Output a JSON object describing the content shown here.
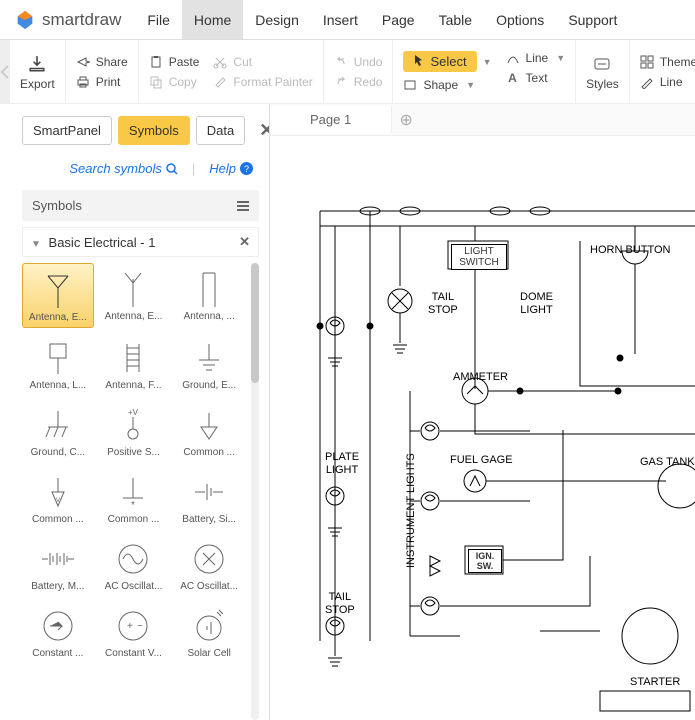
{
  "app": {
    "name": "smartdraw"
  },
  "menu": [
    "File",
    "Home",
    "Design",
    "Insert",
    "Page",
    "Table",
    "Options",
    "Support"
  ],
  "menu_active": "Home",
  "ribbon": {
    "export": "Export",
    "share": "Share",
    "print": "Print",
    "paste": "Paste",
    "copy": "Copy",
    "cut": "Cut",
    "format_painter": "Format Painter",
    "undo": "Undo",
    "redo": "Redo",
    "select": "Select",
    "shape": "Shape",
    "line": "Line",
    "text": "Text",
    "styles": "Styles",
    "themes": "Themes",
    "line2": "Line"
  },
  "panel": {
    "tabs": [
      "SmartPanel",
      "Symbols",
      "Data"
    ],
    "active": "Symbols",
    "search": "Search symbols",
    "help": "Help",
    "symbols_header": "Symbols",
    "group": "Basic Electrical - 1",
    "items": [
      "Antenna, E...",
      "Antenna, E...",
      "Antenna, ...",
      "Antenna, L...",
      "Antenna, F...",
      "Ground, E...",
      "Ground, C...",
      "Positive S...",
      "Common ...",
      "Common ...",
      "Common ...",
      "Battery, Si...",
      "Battery, M...",
      "AC Oscillat...",
      "AC Oscillat...",
      "Constant ...",
      "Constant V...",
      "Solar Cell"
    ]
  },
  "doc": {
    "page": "Page 1"
  },
  "diagram": {
    "labels": {
      "tail_stop": "TAIL\nSTOP",
      "dome_light": "DOME\nLIGHT",
      "light_switch": "LIGHT\nSWITCH",
      "horn_button": "HORN BUTTON",
      "ammeter": "AMMETER",
      "plate_light": "PLATE\nLIGHT",
      "fuel_gage": "FUEL GAGE",
      "gas_tank": "GAS TANK",
      "instrument_lights": "INSTRUMENT LIGHTS",
      "ign_sw": "IGN.\nSW.",
      "tail_stop2": "TAIL\nSTOP",
      "starter": "STARTER"
    }
  }
}
